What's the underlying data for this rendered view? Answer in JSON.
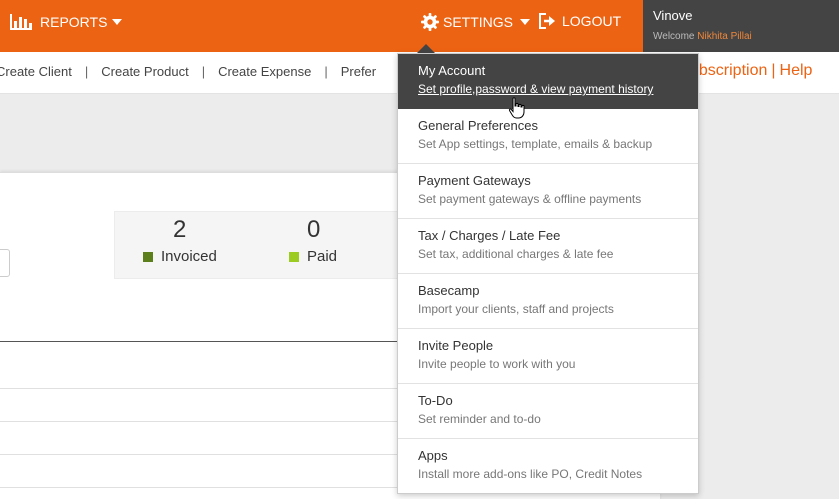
{
  "topbar": {
    "reports_label": "REPORTS",
    "settings_label": "SETTINGS",
    "logout_label": "LOGOUT",
    "company": "Vinove",
    "welcome": "Welcome",
    "username": "Nikhita Pillai",
    "bg_color": "#ec6313"
  },
  "quicklinks": {
    "items": [
      "Create Client",
      "Create Product",
      "Create Expense",
      "Prefer"
    ],
    "separator": "|",
    "subscription": "ubscription",
    "help": "Help"
  },
  "stats": {
    "invoiced": {
      "count": "2",
      "label": "Invoiced",
      "color": "#5c7f1c"
    },
    "paid": {
      "count": "0",
      "label": "Paid",
      "color": "#9ccb22"
    }
  },
  "menu": {
    "items": [
      {
        "title": "My Account",
        "desc": "Set profile,password & view payment history"
      },
      {
        "title": "General Preferences",
        "desc": "Set App settings, template, emails & backup"
      },
      {
        "title": "Payment Gateways",
        "desc": "Set payment gateways & offline payments"
      },
      {
        "title": "Tax / Charges / Late Fee",
        "desc": "Set tax, additional charges & late fee"
      },
      {
        "title": "Basecamp",
        "desc": "Import your clients, staff and projects"
      },
      {
        "title": "Invite People",
        "desc": "Invite people to work with you"
      },
      {
        "title": "To-Do",
        "desc": "Set reminder and to-do"
      },
      {
        "title": "Apps",
        "desc": "Install more add-ons like PO, Credit Notes"
      }
    ]
  }
}
